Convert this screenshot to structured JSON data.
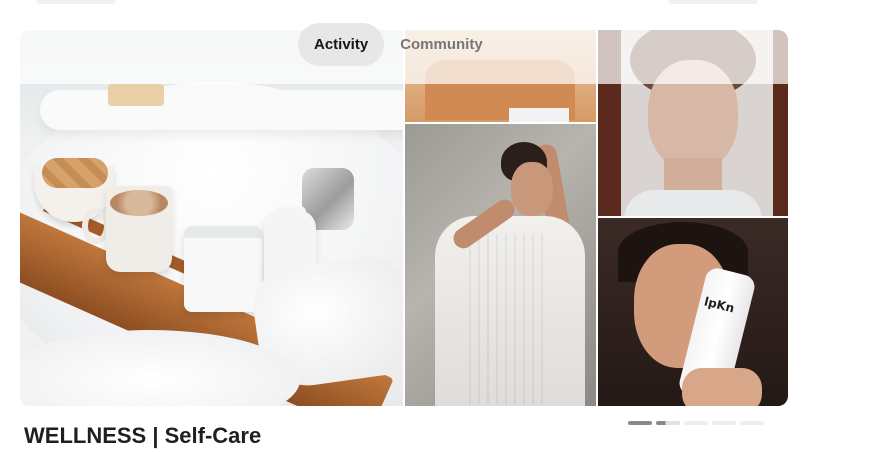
{
  "tabs": [
    {
      "label": "Activity",
      "active": true
    },
    {
      "label": "Community",
      "active": false
    }
  ],
  "board": {
    "title": "WELLNESS | Self-Care"
  },
  "images": {
    "product_tube_text": "lpKn"
  },
  "carousel": {
    "total": 5,
    "current": 1
  },
  "colors": {
    "active_tab_bg": "#e7e7e7",
    "title_text": "#1f1f1f",
    "inactive_tab_text": "#767676"
  }
}
